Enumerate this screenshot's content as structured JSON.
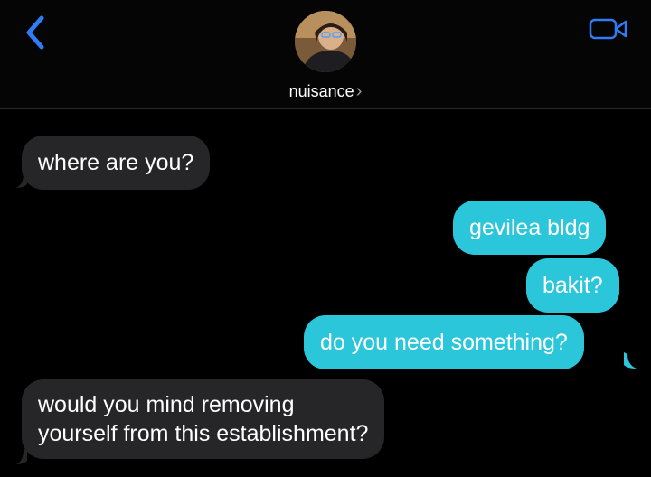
{
  "header": {
    "contact_name": "nuisance",
    "chevron": "›",
    "back_icon": "chevron-left-icon",
    "video_icon": "video-camera-icon",
    "accent_color": "#2f7cf6"
  },
  "messages": [
    {
      "direction": "incoming",
      "text": "where are you?"
    },
    {
      "direction": "outgoing",
      "text": "gevilea bldg"
    },
    {
      "direction": "outgoing",
      "text": "bakit?"
    },
    {
      "direction": "outgoing",
      "text": "do you need something?"
    },
    {
      "direction": "incoming",
      "text_line1": "would you mind removing",
      "text_line2": "yourself from this establishment?"
    }
  ],
  "colors": {
    "incoming_bubble": "#262628",
    "outgoing_bubble": "#2bc6da",
    "background": "#000000"
  }
}
